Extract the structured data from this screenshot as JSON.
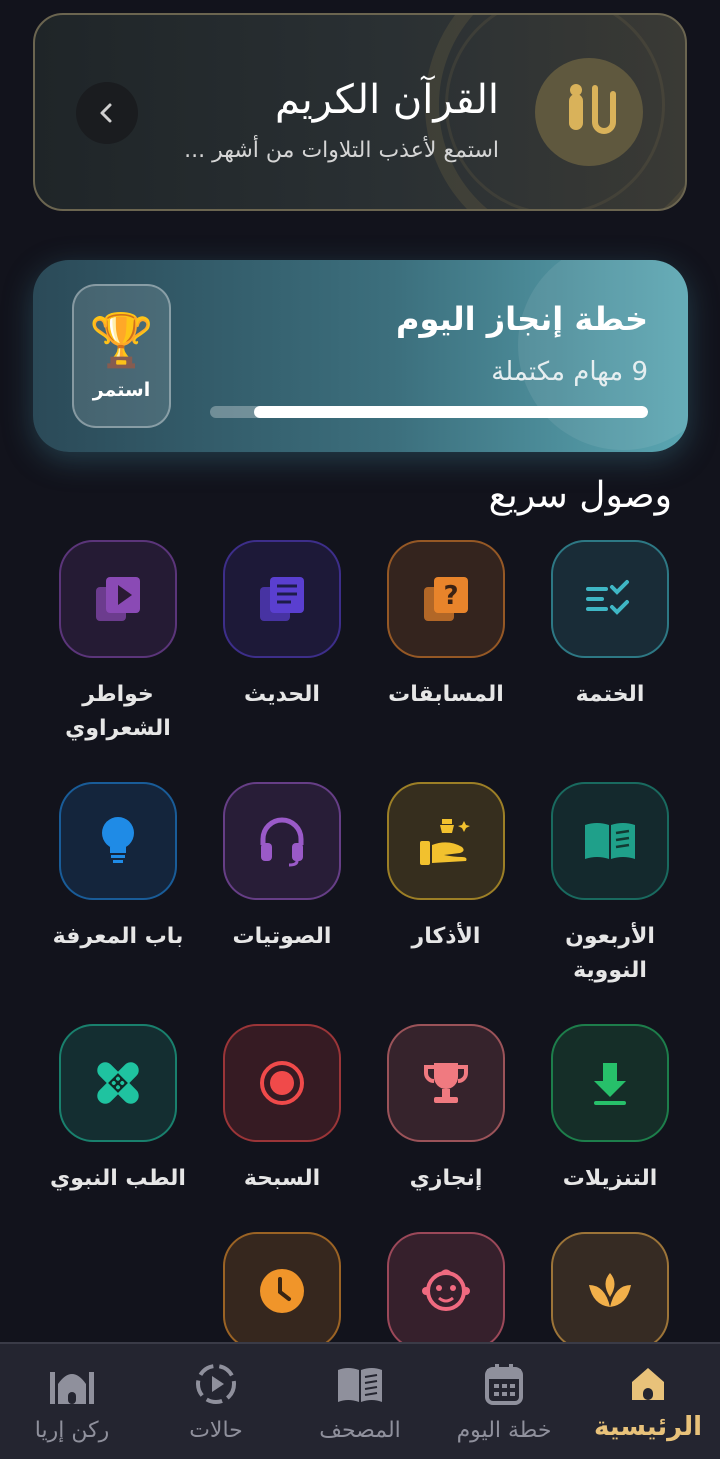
{
  "quran_banner": {
    "title": "القرآن الكريم",
    "subtitle": "استمع لأعذب التلاوات من أشهر ..."
  },
  "plan": {
    "title": "خطة إنجاز اليوم",
    "subtitle": "9 مهام مكتملة",
    "progress_fraction": 0.9,
    "button_label": "استمر"
  },
  "quick_access": {
    "title": "وصول سريع",
    "items": [
      {
        "label": "الختمة",
        "icon": "checklist-icon",
        "color": "#3fb7c5"
      },
      {
        "label": "المسابقات",
        "icon": "quiz-icon",
        "color": "#e8842b"
      },
      {
        "label": "الحديث",
        "icon": "books-icon",
        "color": "#5a3fd0"
      },
      {
        "label": "خواطر الشعراوي",
        "icon": "video-library-icon",
        "color": "#8a4ab5"
      },
      {
        "label": "الأربعون النووية",
        "icon": "open-book-icon",
        "color": "#1fa08a"
      },
      {
        "label": "الأذكار",
        "icon": "hand-prayer-icon",
        "color": "#f2c12e"
      },
      {
        "label": "الصوتيات",
        "icon": "headphones-icon",
        "color": "#9a5ac8"
      },
      {
        "label": "باب المعرفة",
        "icon": "lightbulb-icon",
        "color": "#1f8be6"
      },
      {
        "label": "التنزيلات",
        "icon": "download-icon",
        "color": "#27c06a"
      },
      {
        "label": "إنجازي",
        "icon": "trophy-icon",
        "color": "#f07a80"
      },
      {
        "label": "السبحة",
        "icon": "record-icon",
        "color": "#f04a4a"
      },
      {
        "label": "الطب النبوي",
        "icon": "bandage-icon",
        "color": "#1fc3a0"
      },
      {
        "label": "",
        "icon": "lotus-icon",
        "color": "#f2b04a"
      },
      {
        "label": "",
        "icon": "baby-face-icon",
        "color": "#f06a80"
      },
      {
        "label": "",
        "icon": "clock-icon",
        "color": "#f0952a"
      }
    ]
  },
  "bottom_nav": {
    "items": [
      {
        "label": "الرئيسية",
        "icon": "home-icon",
        "active": true
      },
      {
        "label": "خطة اليوم",
        "icon": "calendar-icon",
        "active": false
      },
      {
        "label": "المصحف",
        "icon": "book-icon",
        "active": false
      },
      {
        "label": "حالات",
        "icon": "status-play-icon",
        "active": false
      },
      {
        "label": "ركن إريا",
        "icon": "mosque-icon",
        "active": false
      }
    ]
  }
}
